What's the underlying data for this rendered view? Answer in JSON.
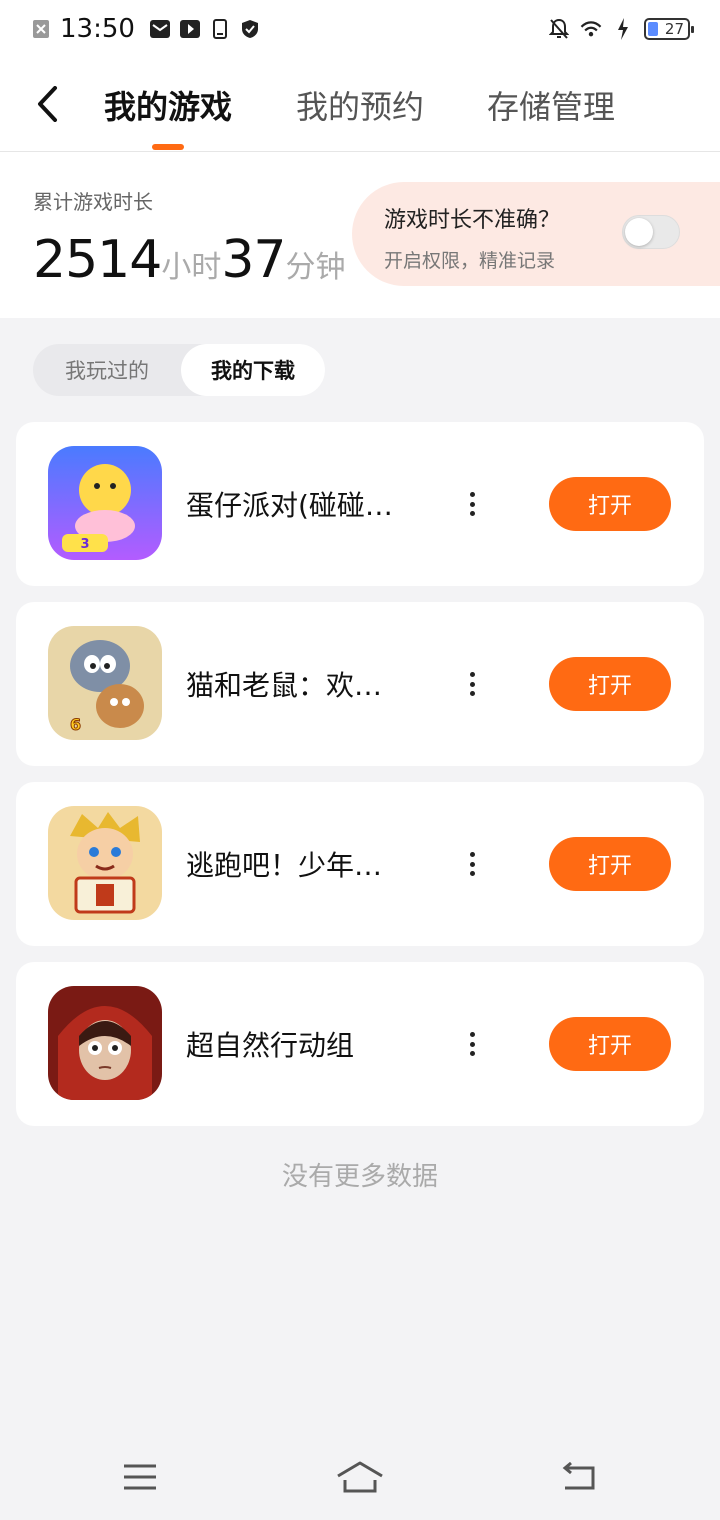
{
  "status_bar": {
    "time": "13:50",
    "battery": "27"
  },
  "header": {
    "tabs": [
      {
        "label": "我的游戏",
        "active": true
      },
      {
        "label": "我的预约",
        "active": false
      },
      {
        "label": "存储管理",
        "active": false
      }
    ]
  },
  "stats": {
    "label": "累计游戏时长",
    "hours": "2514",
    "hours_unit": "小时",
    "minutes": "37",
    "minutes_unit": "分钟",
    "prompt_title": "游戏时长不准确？",
    "prompt_sub": "开启权限，精准记录",
    "toggle_on": false
  },
  "segments": [
    {
      "label": "我玩过的",
      "active": false
    },
    {
      "label": "我的下载",
      "active": true
    }
  ],
  "games": [
    {
      "name": "蛋仔派对(碰碰…",
      "button": "打开",
      "icon": "eggy-party-icon"
    },
    {
      "name": "猫和老鼠：欢…",
      "button": "打开",
      "icon": "tom-and-jerry-icon"
    },
    {
      "name": "逃跑吧！少年…",
      "button": "打开",
      "icon": "run-boy-icon"
    },
    {
      "name": "超自然行动组",
      "button": "打开",
      "icon": "supernatural-squad-icon"
    }
  ],
  "footer_text": "没有更多数据",
  "colors": {
    "accent": "#ff6a13",
    "prompt_bg": "#fde9e3",
    "page_bg": "#f3f3f5"
  }
}
